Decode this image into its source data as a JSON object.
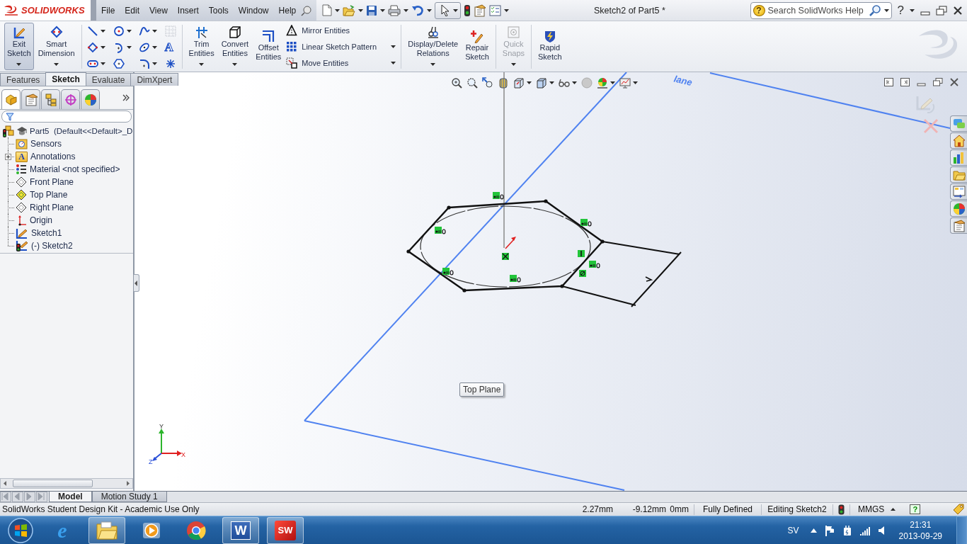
{
  "title_bar": {
    "logo": "SOLIDWORKS",
    "menu": [
      "File",
      "Edit",
      "View",
      "Insert",
      "Tools",
      "Window",
      "Help"
    ],
    "document_title": "Sketch2 of Part5 *",
    "search": {
      "placeholder": "Search SolidWorks Help",
      "glyph": "?"
    },
    "help_glyph": "?"
  },
  "command_manager": {
    "groups": [
      {
        "kind": "large",
        "buttons": [
          {
            "label": "Exit Sketch",
            "pressed": true,
            "disabled": false,
            "dropdown": true
          },
          {
            "label": "Smart Dimension",
            "pressed": false,
            "disabled": false,
            "dropdown": true
          }
        ]
      },
      {
        "kind": "grid",
        "glyph": "A"
      },
      {
        "kind": "large",
        "buttons": [
          {
            "label": "Trim Entities",
            "pressed": false,
            "disabled": false,
            "dropdown": true
          },
          {
            "label": "Convert Entities",
            "pressed": false,
            "disabled": false,
            "dropdown": true
          },
          {
            "label": "Offset Entities",
            "pressed": false,
            "disabled": false,
            "dropdown": false
          }
        ]
      },
      {
        "kind": "list",
        "buttons": [
          {
            "label": "Mirror Entities",
            "dropdown": false
          },
          {
            "label": "Linear Sketch Pattern",
            "dropdown": true
          },
          {
            "label": "Move Entities",
            "dropdown": true
          }
        ]
      },
      {
        "kind": "large",
        "buttons": [
          {
            "label": "Display/Delete Relations",
            "pressed": false,
            "disabled": false,
            "dropdown": true
          },
          {
            "label": "Repair Sketch",
            "pressed": false,
            "disabled": false,
            "dropdown": false
          }
        ]
      },
      {
        "kind": "large",
        "buttons": [
          {
            "label": "Quick Snaps",
            "pressed": false,
            "disabled": true,
            "dropdown": true
          }
        ]
      },
      {
        "kind": "large",
        "buttons": [
          {
            "label": "Rapid Sketch",
            "pressed": false,
            "disabled": false,
            "dropdown": false
          }
        ]
      }
    ]
  },
  "tabs": [
    {
      "label": "Features",
      "selected": false
    },
    {
      "label": "Sketch",
      "selected": true
    },
    {
      "label": "Evaluate",
      "selected": false
    },
    {
      "label": "DimXpert",
      "selected": false
    }
  ],
  "feature_manager": {
    "panel_tabs": [
      {
        "selected": true
      },
      {
        "selected": false
      },
      {
        "selected": false
      },
      {
        "selected": false
      },
      {
        "selected": false
      }
    ],
    "tree": {
      "label": "Part5  (Default<<Default>_D",
      "children": [
        {
          "label": "Sensors",
          "kind": "sensors",
          "collapsed": false,
          "highlighted": false
        },
        {
          "label": "Annotations",
          "kind": "annotations",
          "glyph": "A",
          "collapsed": true,
          "highlighted": false
        },
        {
          "label": "Material <not specified>",
          "kind": "material",
          "collapsed": false,
          "highlighted": false
        },
        {
          "label": "Front Plane",
          "kind": "plane",
          "collapsed": false,
          "highlighted": false
        },
        {
          "label": "Top Plane",
          "kind": "plane",
          "collapsed": false,
          "highlighted": true
        },
        {
          "label": "Right Plane",
          "kind": "plane",
          "collapsed": false,
          "highlighted": false
        },
        {
          "label": "Origin",
          "kind": "origin",
          "collapsed": false,
          "highlighted": false
        },
        {
          "label": "Sketch1",
          "kind": "sketch",
          "collapsed": false,
          "highlighted": false
        },
        {
          "label": "(-) Sketch2",
          "kind": "active-sketch",
          "collapsed": false,
          "highlighted": false
        }
      ]
    }
  },
  "viewport": {
    "plane_label": "lane",
    "tooltip": "Top Plane",
    "triad": {
      "x": "X",
      "y": "Y",
      "z": "Z"
    }
  },
  "bottom_tabs": [
    {
      "label": "Model",
      "selected": true
    },
    {
      "label": "Motion Study 1",
      "selected": false
    }
  ],
  "status_bar": {
    "message": "SolidWorks Student Design Kit - Academic Use Only",
    "fields": [
      "2.27mm",
      "-9.12mm",
      "0mm",
      "Fully Defined",
      "Editing Sketch2"
    ],
    "units": "MMGS",
    "help_glyph": "?"
  },
  "taskbar": {
    "apps": [
      {
        "running": false,
        "glyph": "e"
      },
      {
        "running": true
      },
      {
        "running": false
      },
      {
        "running": false
      },
      {
        "running": true,
        "glyph": "W"
      },
      {
        "running": true,
        "glyph": "SW"
      }
    ],
    "language": "SV",
    "time": "21:31",
    "date": "2013-09-29"
  }
}
